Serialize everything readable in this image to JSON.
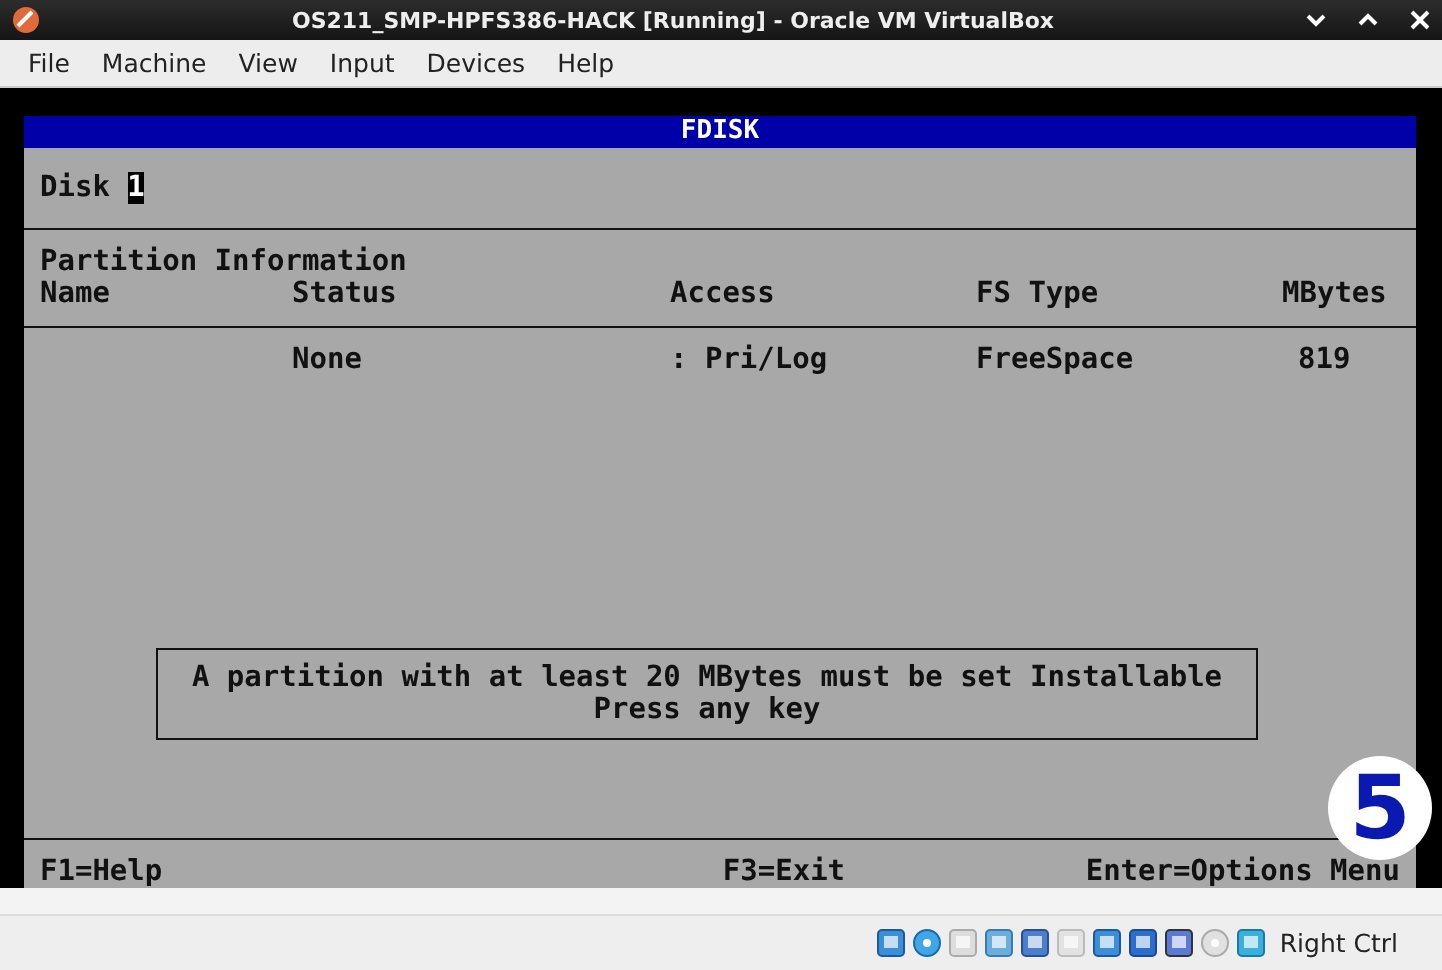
{
  "window": {
    "title": "OS211_SMP-HPFS386-HACK [Running] - Oracle VM VirtualBox"
  },
  "menu": [
    "File",
    "Machine",
    "View",
    "Input",
    "Devices",
    "Help"
  ],
  "screen": {
    "header": "FDISK",
    "disk_label": "Disk",
    "disk_number": "1",
    "section_title": "Partition Information",
    "columns": [
      "Name",
      "Status",
      "Access",
      "FS Type",
      "MBytes"
    ],
    "rows": [
      {
        "cells": [
          "",
          "None",
          ": Pri/Log",
          "FreeSpace",
          "819"
        ]
      }
    ],
    "message": [
      "A partition with at least 20 MBytes must be set Installable",
      "Press any key"
    ],
    "function_keys": [
      "F1=Help",
      "F3=Exit",
      "Enter=Options Menu"
    ]
  },
  "step_badge": "5",
  "status_bar": {
    "host_key": "Right Ctrl"
  }
}
